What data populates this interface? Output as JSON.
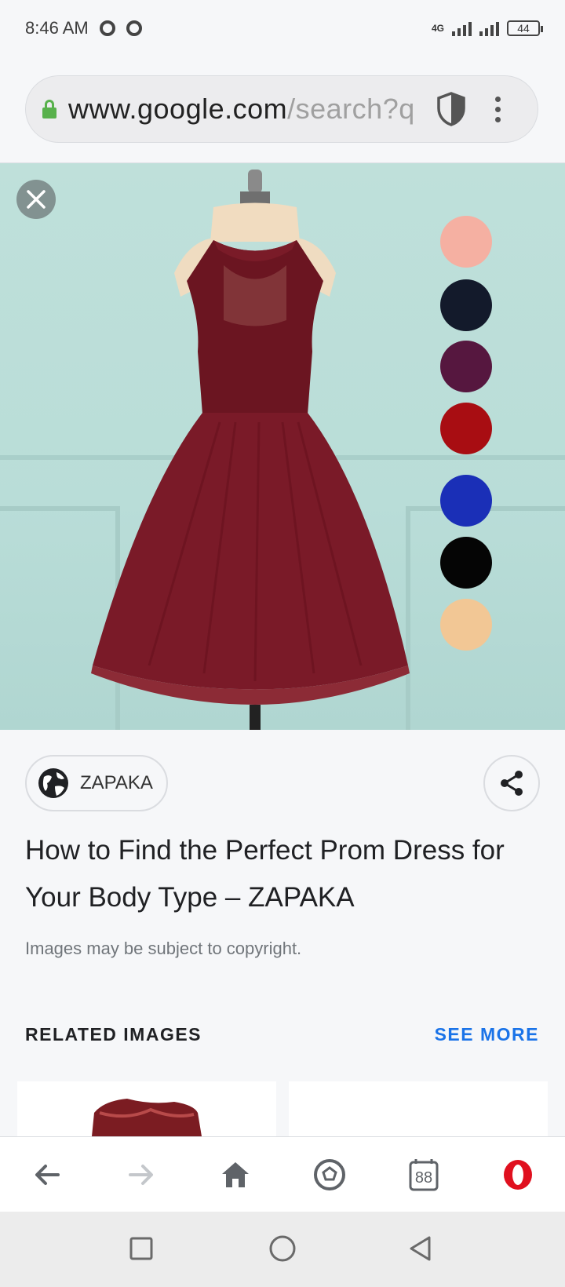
{
  "status_bar": {
    "time": "8:46 AM",
    "network": "4G",
    "battery": "44"
  },
  "url_bar": {
    "host": "www.google.com",
    "path": "/search?q",
    "icons": [
      "lock-icon",
      "shield-icon",
      "more-vert-icon"
    ]
  },
  "image": {
    "description_colors": {
      "background": "#bfe0da",
      "dress": "#6e1a25"
    },
    "swatches": [
      "#f5b0a2",
      "#131a2b",
      "#56173f",
      "#a80d12",
      "#1a2fb7",
      "#050505",
      "#f2c795"
    ]
  },
  "source": {
    "name": "ZAPAKA"
  },
  "title": "How to Find the Perfect Prom Dress for Your Body Type – ZAPAKA",
  "copyright_note": "Images may be subject to copyright.",
  "related": {
    "heading": "RELATED IMAGES",
    "see_more": "SEE MORE"
  },
  "bottom_bar": {
    "tab_count": "88",
    "icons": [
      "back-arrow-icon",
      "forward-arrow-icon",
      "home-icon",
      "speed-dial-icon",
      "tabs-icon",
      "opera-icon"
    ]
  },
  "system_nav": {
    "icons": [
      "recents-icon",
      "home-circle-icon",
      "back-triangle-icon"
    ]
  }
}
